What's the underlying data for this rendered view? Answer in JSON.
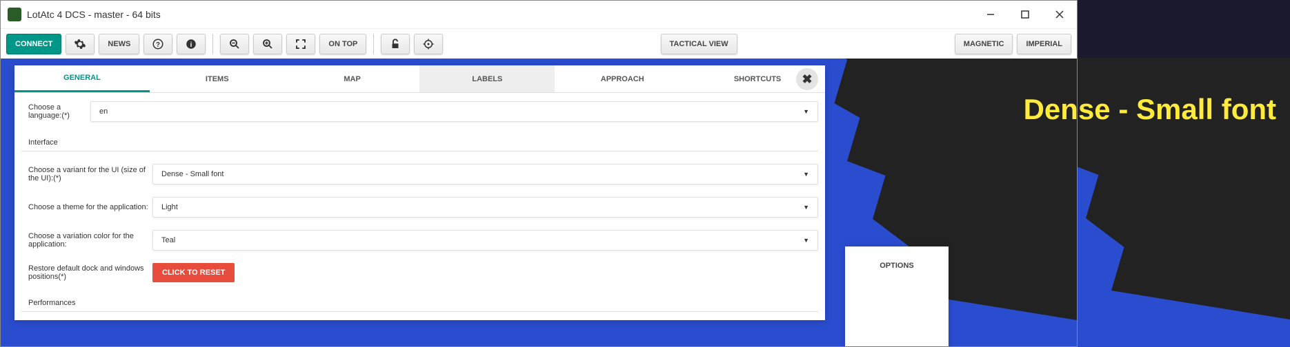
{
  "window": {
    "title": "LotAtc 4 DCS - master - 64 bits"
  },
  "toolbar": {
    "connect": "CONNECT",
    "news": "NEWS",
    "on_top": "ON TOP",
    "tactical_view": "TACTICAL VIEW",
    "magnetic": "MAGNETIC",
    "imperial": "IMPERIAL"
  },
  "tabs": {
    "general": "GENERAL",
    "items": "ITEMS",
    "map": "MAP",
    "labels": "LABELS",
    "approach": "APPROACH",
    "shortcuts": "SHORTCUTS"
  },
  "settings": {
    "language_label": "Choose a language:(*)",
    "language_value": "en",
    "interface_section": "Interface",
    "variant_label": "Choose a variant for the UI (size of the UI):(*)",
    "variant_value": "Dense - Small font",
    "theme_label": "Choose a theme for the application:",
    "theme_value": "Light",
    "color_label": "Choose a variation color for the application:",
    "color_value": "Teal",
    "reset_label": "Restore default dock and windows positions(*)",
    "reset_button": "CLICK TO RESET",
    "performances_section": "Performances"
  },
  "options_panel": {
    "title": "OPTIONS"
  },
  "annotation": "Dense - Small font"
}
